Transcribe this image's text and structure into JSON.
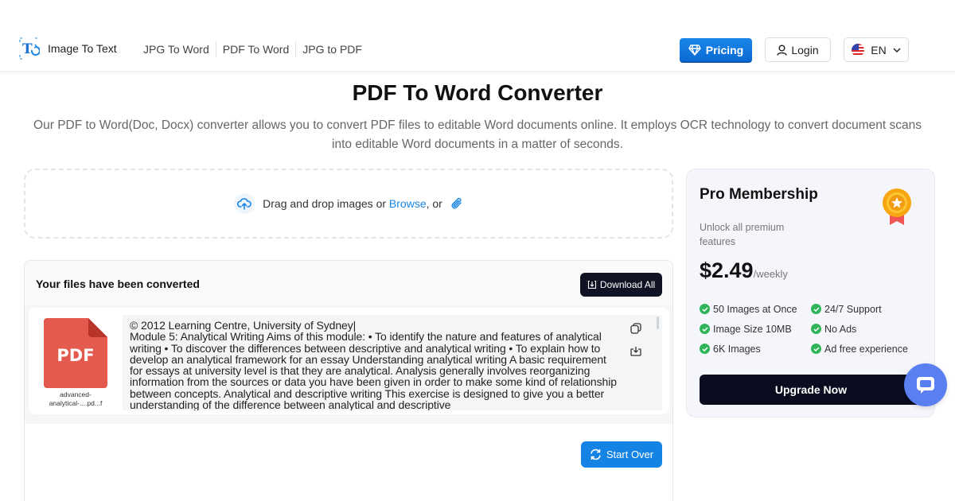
{
  "header": {
    "logo_text": "Image To Text",
    "nav": [
      "JPG To Word",
      "PDF To Word",
      "JPG to PDF"
    ],
    "pricing_label": "Pricing",
    "login_label": "Login",
    "language": "EN"
  },
  "main": {
    "title": "PDF To Word Converter",
    "description": "Our PDF to Word(Doc, Docx) converter allows you to convert PDF files to editable Word documents online. It employs OCR technology to convert document scans into editable Word documents in a matter of seconds."
  },
  "dropzone": {
    "text_before": "Drag and drop images or ",
    "browse_label": "Browse",
    "text_after": ", or"
  },
  "results": {
    "title": "Your files have been converted",
    "download_all_label": "Download All",
    "files": [
      {
        "type_label": "PDF",
        "name": "advanced-analytical-....pd...f",
        "text": "© 2012 Learning Centre, University of Sydney|\nModule 5:  Analytical Writing Aims of this module: • To identify the nature and features of analytical writing • To discover the differences between descriptive and analytical writing • To explain how to develop an analytical framework for an essay  Understanding analytical writing  A basic requirement for essays at university level is that they are analytical. Analysis generally involves reorganizing information from the sources or data you have been given in order to make some kind of relationship between concepts.   Analytical and descriptive writing  This exercise is designed to give you a better understanding of the difference between analytical and descriptive"
      }
    ],
    "start_over_label": "Start Over"
  },
  "pro_card": {
    "title": "Pro Membership",
    "subtitle": "Unlock all premium features",
    "price": "$2.49",
    "period": "/weekly",
    "features": [
      "50 Images at Once",
      "24/7 Support",
      "Image Size 10MB",
      "No Ads",
      "6K Images",
      "Ad free experience"
    ],
    "upgrade_label": "Upgrade Now"
  },
  "colors": {
    "primary_blue": "#1483e3",
    "dark_button": "#0f1324",
    "check_green": "#2fb45a",
    "pdf_red": "#e55a4e",
    "chat_fab": "#5a7ff0"
  }
}
